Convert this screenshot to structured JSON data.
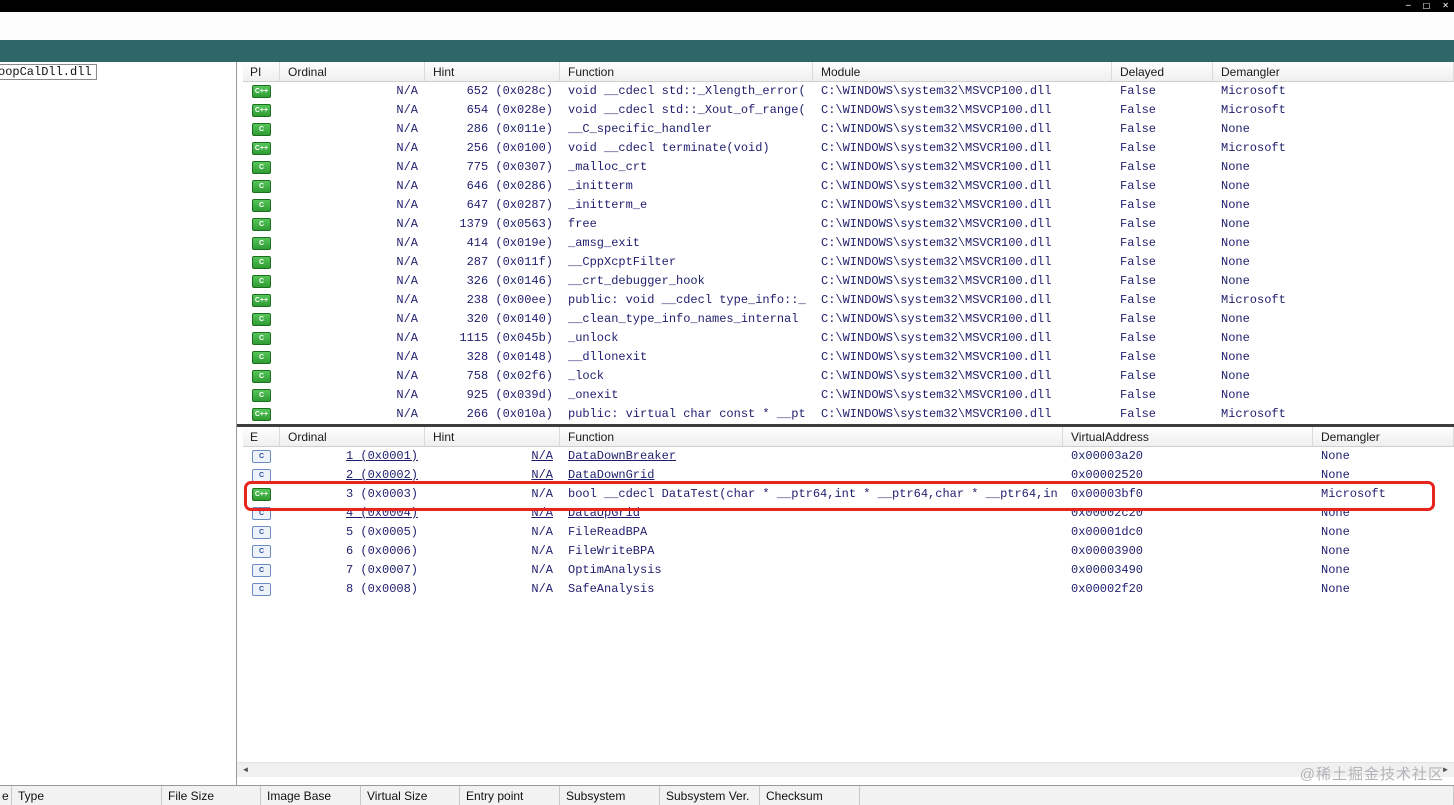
{
  "window": {
    "controls": {
      "minimize": "─",
      "maximize": "□",
      "close": "✕"
    }
  },
  "tree": {
    "selected_item": "oopCalDll.dll"
  },
  "imports": {
    "columns": [
      "PI",
      "Ordinal",
      "Hint",
      "Function",
      "Module",
      "Delayed",
      "Demangler"
    ],
    "rows": [
      {
        "icon": "cpp-green",
        "ordinal": "N/A",
        "hint": "652 (0x028c)",
        "function": "void __cdecl std::_Xlength_error(",
        "module": "C:\\WINDOWS\\system32\\MSVCP100.dll",
        "delayed": "False",
        "demangler": "Microsoft"
      },
      {
        "icon": "cpp-green",
        "ordinal": "N/A",
        "hint": "654 (0x028e)",
        "function": "void __cdecl std::_Xout_of_range(",
        "module": "C:\\WINDOWS\\system32\\MSVCP100.dll",
        "delayed": "False",
        "demangler": "Microsoft"
      },
      {
        "icon": "c-green",
        "ordinal": "N/A",
        "hint": "286 (0x011e)",
        "function": "__C_specific_handler",
        "module": "C:\\WINDOWS\\system32\\MSVCR100.dll",
        "delayed": "False",
        "demangler": "None"
      },
      {
        "icon": "cpp-green",
        "ordinal": "N/A",
        "hint": "256 (0x0100)",
        "function": "void __cdecl terminate(void)",
        "module": "C:\\WINDOWS\\system32\\MSVCR100.dll",
        "delayed": "False",
        "demangler": "Microsoft"
      },
      {
        "icon": "c-green",
        "ordinal": "N/A",
        "hint": "775 (0x0307)",
        "function": "_malloc_crt",
        "module": "C:\\WINDOWS\\system32\\MSVCR100.dll",
        "delayed": "False",
        "demangler": "None"
      },
      {
        "icon": "c-green",
        "ordinal": "N/A",
        "hint": "646 (0x0286)",
        "function": "_initterm",
        "module": "C:\\WINDOWS\\system32\\MSVCR100.dll",
        "delayed": "False",
        "demangler": "None"
      },
      {
        "icon": "c-green",
        "ordinal": "N/A",
        "hint": "647 (0x0287)",
        "function": "_initterm_e",
        "module": "C:\\WINDOWS\\system32\\MSVCR100.dll",
        "delayed": "False",
        "demangler": "None"
      },
      {
        "icon": "c-green",
        "ordinal": "N/A",
        "hint": "1379 (0x0563)",
        "function": "free",
        "module": "C:\\WINDOWS\\system32\\MSVCR100.dll",
        "delayed": "False",
        "demangler": "None"
      },
      {
        "icon": "c-green",
        "ordinal": "N/A",
        "hint": "414 (0x019e)",
        "function": "_amsg_exit",
        "module": "C:\\WINDOWS\\system32\\MSVCR100.dll",
        "delayed": "False",
        "demangler": "None"
      },
      {
        "icon": "c-green",
        "ordinal": "N/A",
        "hint": "287 (0x011f)",
        "function": "__CppXcptFilter",
        "module": "C:\\WINDOWS\\system32\\MSVCR100.dll",
        "delayed": "False",
        "demangler": "None"
      },
      {
        "icon": "c-green",
        "ordinal": "N/A",
        "hint": "326 (0x0146)",
        "function": "__crt_debugger_hook",
        "module": "C:\\WINDOWS\\system32\\MSVCR100.dll",
        "delayed": "False",
        "demangler": "None"
      },
      {
        "icon": "cpp-green",
        "ordinal": "N/A",
        "hint": "238 (0x00ee)",
        "function": "public: void __cdecl type_info::_",
        "module": "C:\\WINDOWS\\system32\\MSVCR100.dll",
        "delayed": "False",
        "demangler": "Microsoft"
      },
      {
        "icon": "c-green",
        "ordinal": "N/A",
        "hint": "320 (0x0140)",
        "function": "__clean_type_info_names_internal",
        "module": "C:\\WINDOWS\\system32\\MSVCR100.dll",
        "delayed": "False",
        "demangler": "None"
      },
      {
        "icon": "c-green",
        "ordinal": "N/A",
        "hint": "1115 (0x045b)",
        "function": "_unlock",
        "module": "C:\\WINDOWS\\system32\\MSVCR100.dll",
        "delayed": "False",
        "demangler": "None"
      },
      {
        "icon": "c-green",
        "ordinal": "N/A",
        "hint": "328 (0x0148)",
        "function": "__dllonexit",
        "module": "C:\\WINDOWS\\system32\\MSVCR100.dll",
        "delayed": "False",
        "demangler": "None"
      },
      {
        "icon": "c-green",
        "ordinal": "N/A",
        "hint": "758 (0x02f6)",
        "function": "_lock",
        "module": "C:\\WINDOWS\\system32\\MSVCR100.dll",
        "delayed": "False",
        "demangler": "None"
      },
      {
        "icon": "c-green",
        "ordinal": "N/A",
        "hint": "925 (0x039d)",
        "function": "_onexit",
        "module": "C:\\WINDOWS\\system32\\MSVCR100.dll",
        "delayed": "False",
        "demangler": "None"
      },
      {
        "icon": "cpp-green",
        "ordinal": "N/A",
        "hint": "266 (0x010a)",
        "function": "public: virtual char const * __pt",
        "module": "C:\\WINDOWS\\system32\\MSVCR100.dll",
        "delayed": "False",
        "demangler": "Microsoft"
      }
    ]
  },
  "exports": {
    "columns": [
      "E",
      "Ordinal",
      "Hint",
      "Function",
      "VirtualAddress",
      "Demangler"
    ],
    "rows": [
      {
        "icon": "c-blue",
        "ordinal": "1 (0x0001)",
        "hint": "N/A",
        "function": "DataDownBreaker",
        "virtual_address": "0x00003a20",
        "demangler": "None",
        "underline": true,
        "highlighted": false
      },
      {
        "icon": "c-blue",
        "ordinal": "2 (0x0002)",
        "hint": "N/A",
        "function": "DataDownGrid",
        "virtual_address": "0x00002520",
        "demangler": "None",
        "underline": true,
        "highlighted": false
      },
      {
        "icon": "cpp-green",
        "ordinal": "3 (0x0003)",
        "hint": "N/A",
        "function": "bool __cdecl DataTest(char * __ptr64,int * __ptr64,char * __ptr64,in",
        "virtual_address": "0x00003bf0",
        "demangler": "Microsoft",
        "underline": false,
        "highlighted": true
      },
      {
        "icon": "c-blue",
        "ordinal": "4 (0x0004)",
        "hint": "N/A",
        "function": "DataUpGrid",
        "virtual_address": "0x00002c20",
        "demangler": "None",
        "underline": true,
        "highlighted": false
      },
      {
        "icon": "c-blue",
        "ordinal": "5 (0x0005)",
        "hint": "N/A",
        "function": "FileReadBPA",
        "virtual_address": "0x00001dc0",
        "demangler": "None",
        "underline": false,
        "highlighted": false
      },
      {
        "icon": "c-blue",
        "ordinal": "6 (0x0006)",
        "hint": "N/A",
        "function": "FileWriteBPA",
        "virtual_address": "0x00003900",
        "demangler": "None",
        "underline": false,
        "highlighted": false
      },
      {
        "icon": "c-blue",
        "ordinal": "7 (0x0007)",
        "hint": "N/A",
        "function": "OptimAnalysis",
        "virtual_address": "0x00003490",
        "demangler": "None",
        "underline": false,
        "highlighted": false
      },
      {
        "icon": "c-blue",
        "ordinal": "8 (0x0008)",
        "hint": "N/A",
        "function": "SafeAnalysis",
        "virtual_address": "0x00002f20",
        "demangler": "None",
        "underline": false,
        "highlighted": false
      }
    ]
  },
  "footer": {
    "columns": [
      "e",
      "Type",
      "File Size",
      "Image Base",
      "Virtual Size",
      "Entry point",
      "Subsystem",
      "Subsystem Ver.",
      "Checksum"
    ]
  },
  "scrollbar": {
    "left_arrow": "◄",
    "right_arrow": "►"
  },
  "highlight_color": "#e8241f",
  "toolbar_color": "#2e6767",
  "watermark": "@稀土掘金技术社区"
}
